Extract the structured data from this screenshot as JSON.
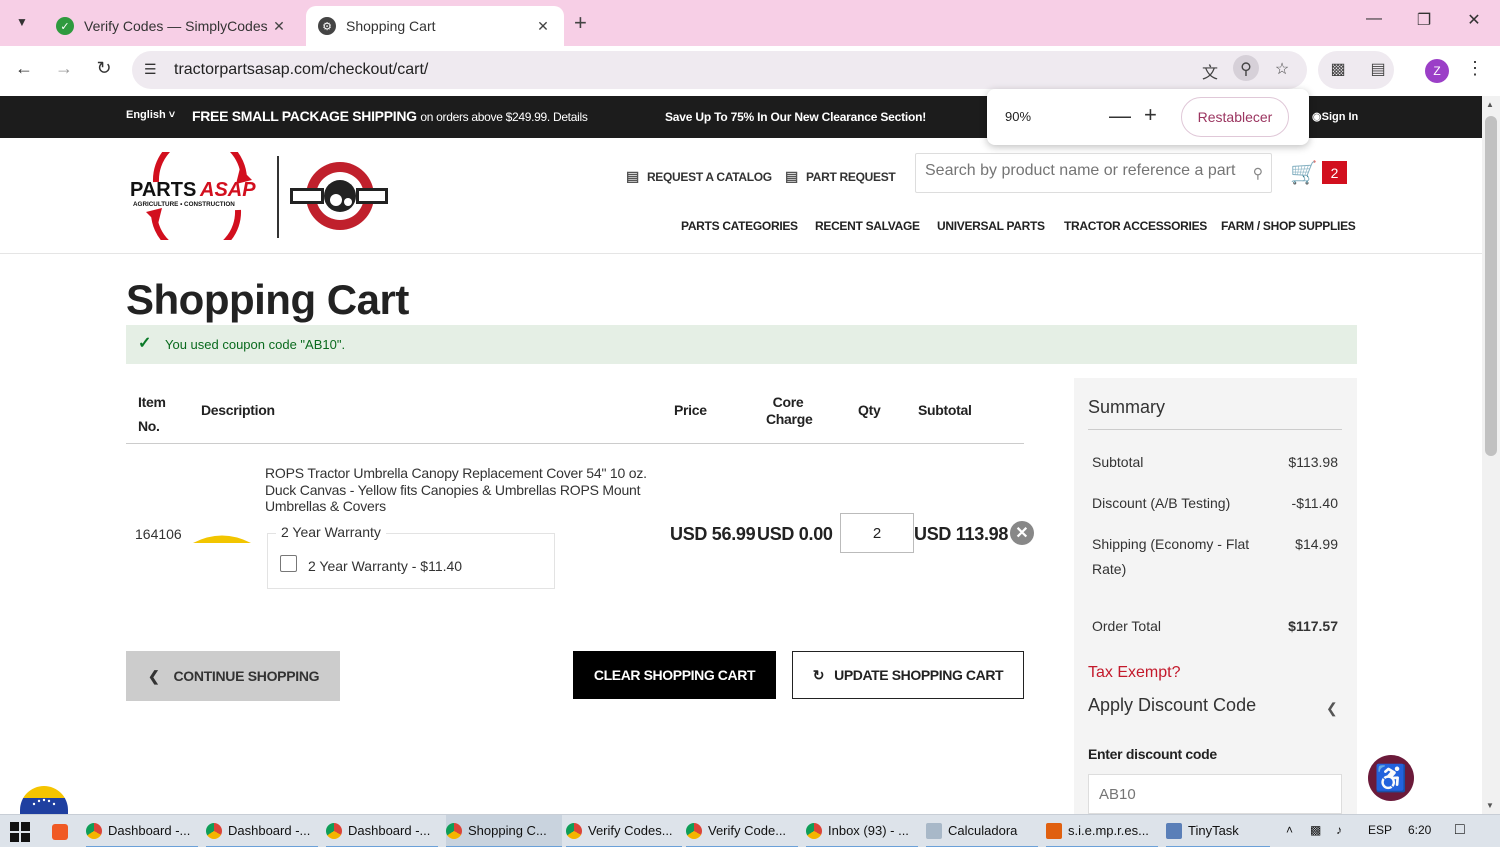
{
  "browser": {
    "tabs": [
      {
        "title": "Verify Codes — SimplyCodes",
        "active": false
      },
      {
        "title": "Shopping Cart",
        "active": true
      }
    ],
    "url": "tractorpartsasap.com/checkout/cart/",
    "zoom": {
      "value": "90%",
      "reset_label": "Restablecer"
    },
    "profile_initial": "Z"
  },
  "site": {
    "language": "English",
    "promo_bold": "FREE SMALL PACKAGE SHIPPING",
    "promo_rest": "on orders above $249.99. Details",
    "clearance": "Save Up To 75% In Our New Clearance Section!",
    "signin": "Sign In",
    "header_links": {
      "catalog": "REQUEST A CATALOG",
      "part": "PART REQUEST"
    },
    "search_placeholder": "Search by product name or reference a part #",
    "cart_count": "2",
    "nav": [
      "PARTS CATEGORIES",
      "RECENT SALVAGE",
      "UNIVERSAL PARTS",
      "TRACTOR ACCESSORIES",
      "FARM / SHOP SUPPLIES"
    ],
    "logo_text": {
      "parts": "PARTS",
      "asap": "ASAP",
      "tagline": "AGRICULTURE • CONSTRUCTION"
    }
  },
  "cart": {
    "title": "Shopping Cart",
    "coupon_message": "You used coupon code \"AB10\".",
    "columns": {
      "item_no_1": "Item",
      "item_no_2": "No.",
      "description": "Description",
      "price": "Price",
      "core_1": "Core",
      "core_2": "Charge",
      "qty": "Qty",
      "subtotal": "Subtotal"
    },
    "item": {
      "item_no": "164106",
      "description": "ROPS Tractor Umbrella Canopy Replacement Cover 54\" 10 oz. Duck Canvas - Yellow fits Canopies & Umbrellas ROPS Mount Umbrellas & Covers",
      "warranty_legend": "2 Year Warranty",
      "warranty_option": "2 Year Warranty - $11.40",
      "price": "USD 56.99",
      "core_charge": "USD 0.00",
      "qty": "2",
      "subtotal": "USD 113.98"
    },
    "buttons": {
      "continue": "CONTINUE SHOPPING",
      "clear": "CLEAR SHOPPING CART",
      "update": "UPDATE SHOPPING CART"
    }
  },
  "summary": {
    "title": "Summary",
    "rows": [
      {
        "label": "Subtotal",
        "value": "$113.98"
      },
      {
        "label": "Discount (A/B Testing)",
        "value": "-$11.40"
      },
      {
        "label": "Shipping (Economy - Flat Rate)",
        "value": "$14.99"
      },
      {
        "label": "Order Total",
        "value": "$117.57"
      }
    ],
    "tax_exempt": "Tax Exempt?",
    "apply_discount": "Apply Discount Code",
    "enter_discount_label": "Enter discount code",
    "discount_placeholder": "AB10"
  },
  "taskbar": {
    "items": [
      "Dashboard -...",
      "Dashboard -...",
      "Dashboard -...",
      "Shopping C...",
      "Verify Codes...",
      "Verify Code...",
      "Inbox (93) - ...",
      "Calculadora",
      "s.i.e.mp.r.es...",
      "TinyTask"
    ],
    "lang": "ESP",
    "time": "6:20"
  },
  "colors": {
    "accent_red": "#d20f1e",
    "tab_bar": "#f7cfe6",
    "coupon_bg": "#e5efe5",
    "coupon_text": "#0a6a1e",
    "tax_link": "#c3192b"
  }
}
